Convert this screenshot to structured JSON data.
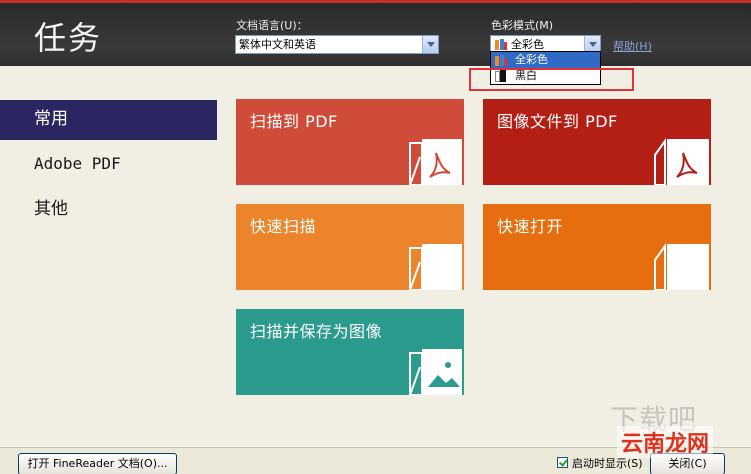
{
  "header": {
    "title": "任务",
    "language_label": "文档语言(U)：",
    "language_value": "繁体中文和英语",
    "color_mode_label": "色彩模式(M)",
    "color_mode_value": "全彩色",
    "help_link": "帮助(H)"
  },
  "color_dropdown": {
    "options": [
      {
        "label": "全彩色",
        "selected": true,
        "icon": "color-mode-icon"
      },
      {
        "label": "黑白",
        "selected": false,
        "icon": "black-white-icon"
      }
    ]
  },
  "sidebar": {
    "items": [
      {
        "label": "常用",
        "active": true
      },
      {
        "label": "Adobe PDF",
        "active": false
      },
      {
        "label": "其他",
        "active": false
      }
    ]
  },
  "tiles": [
    {
      "label": "扫描到 PDF",
      "color": "#cf4b3a",
      "icon": "scan-to-pdf-icon"
    },
    {
      "label": "图像文件到 PDF",
      "color": "#b41f15",
      "icon": "image-to-pdf-icon"
    },
    {
      "label": "快速扫描",
      "color": "#eb842a",
      "icon": "quick-scan-icon"
    },
    {
      "label": "快速打开",
      "color": "#e66e0e",
      "icon": "quick-open-icon"
    },
    {
      "label": "扫描并保存为图像",
      "color": "#2a9b8d",
      "icon": "scan-to-image-icon"
    }
  ],
  "footer": {
    "open_button": "打开 FineReader 文档(O)...",
    "startup_label": "启动时显示(S)",
    "startup_checked": true,
    "close_button": "关闭(C)"
  },
  "watermark": {
    "top": "下载吧",
    "text": "云南龙网"
  },
  "colors": {
    "header_bg": "#333333",
    "sidebar_active": "#2b2661",
    "dropdown_highlight": "#316ac5",
    "annotation_box": "#e0303a"
  }
}
